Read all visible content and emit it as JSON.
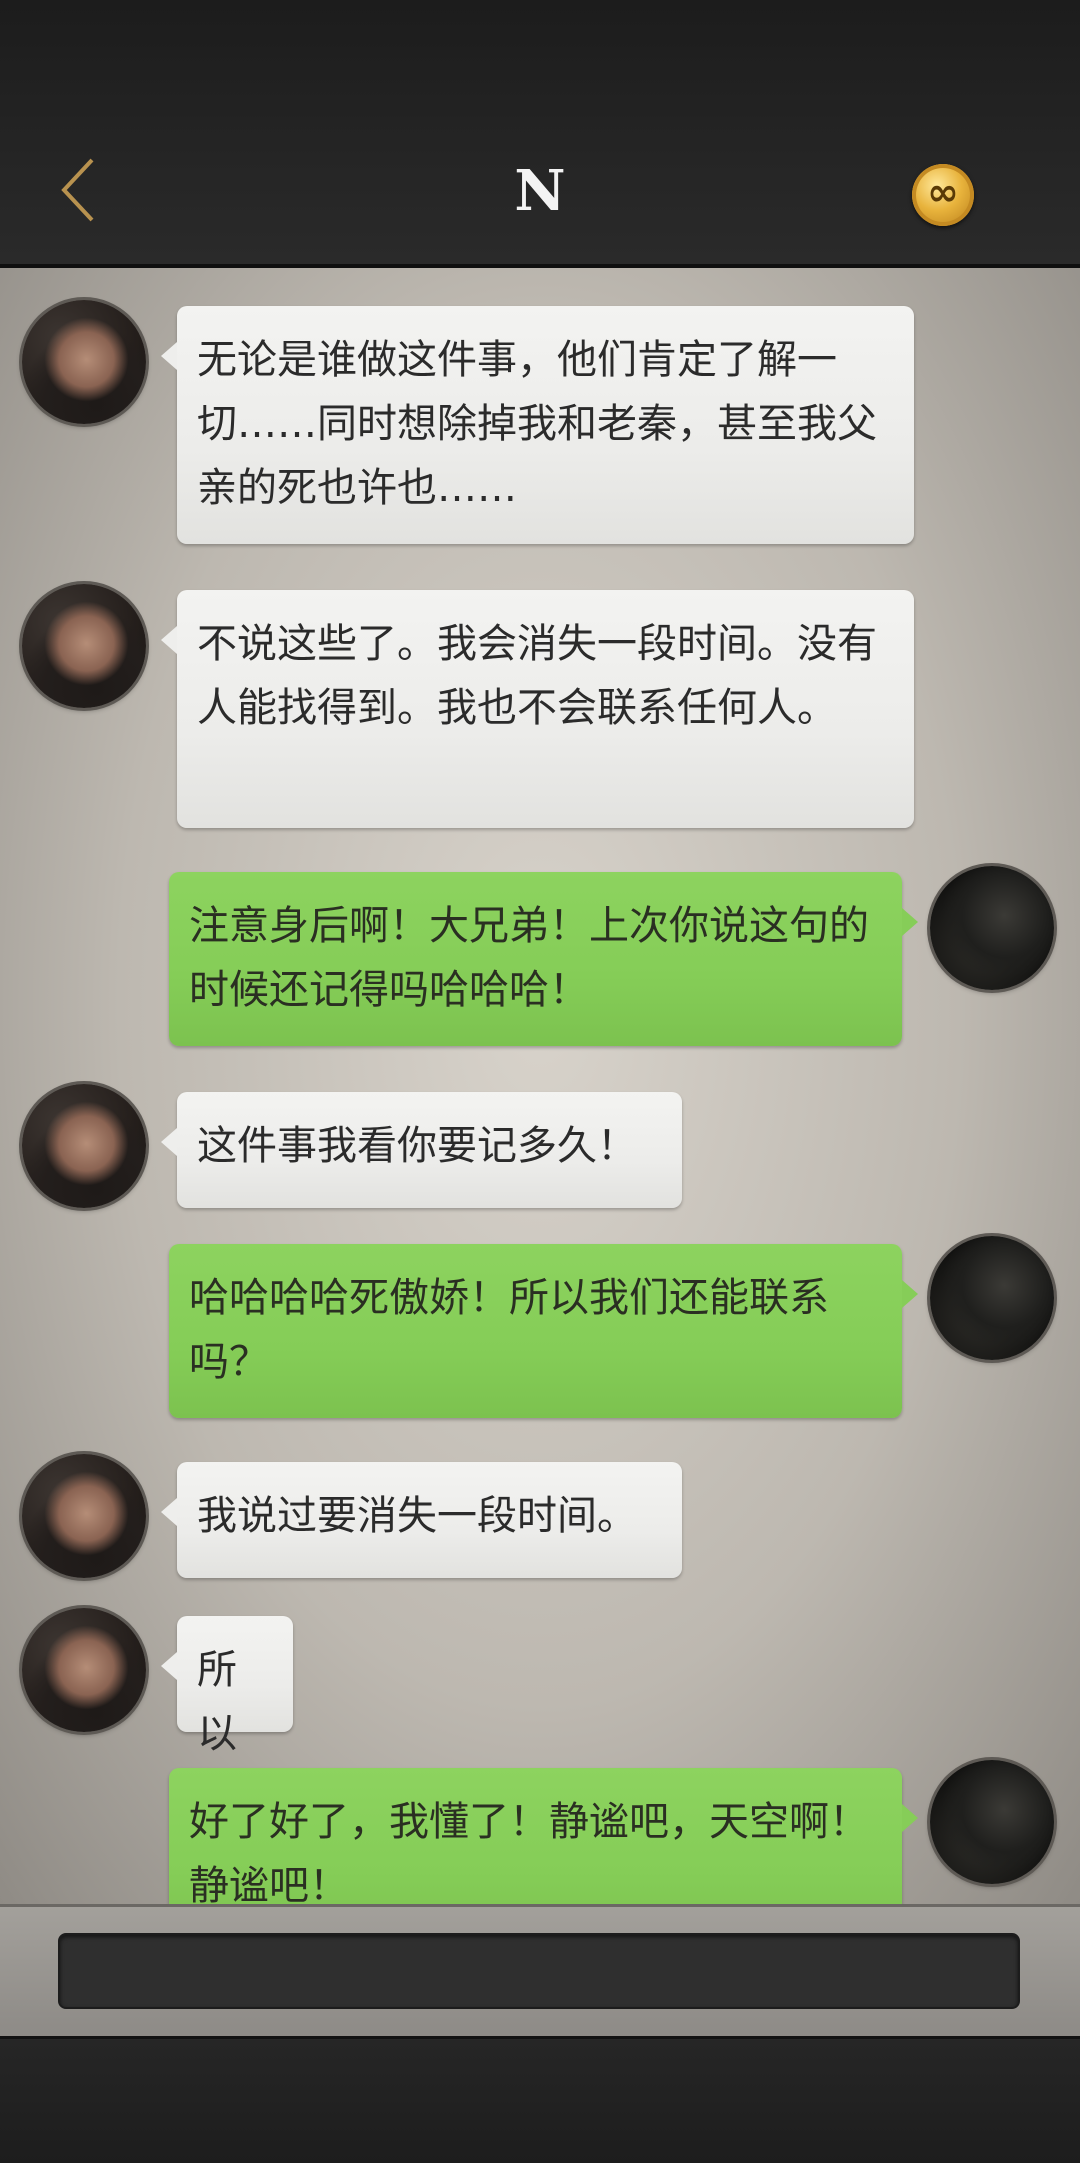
{
  "header": {
    "title": "N",
    "back_icon": "chevron-left-icon",
    "coin_icon": "infinity-coin-icon",
    "coin_symbol": "∞"
  },
  "messages": [
    {
      "side": "left",
      "avatar": "contact-avatar",
      "text": "无论是谁做这件事，他们肯定了解一切……同时想除掉我和老秦，甚至我父亲的死也许也……"
    },
    {
      "side": "left",
      "avatar": "contact-avatar",
      "text": "不说这些了。我会消失一段时间。没有人能找得到。我也不会联系任何人。"
    },
    {
      "side": "right",
      "avatar": "user-avatar",
      "text": "注意身后啊！大兄弟！上次你说这句的时候还记得吗哈哈哈！"
    },
    {
      "side": "left",
      "avatar": "contact-avatar",
      "text": "这件事我看你要记多久！"
    },
    {
      "side": "right",
      "avatar": "user-avatar",
      "text": "哈哈哈哈死傲娇！所以我们还能联系吗？"
    },
    {
      "side": "left",
      "avatar": "contact-avatar",
      "text": "我说过要消失一段时间。"
    },
    {
      "side": "left",
      "avatar": "contact-avatar",
      "text": "所以"
    },
    {
      "side": "right",
      "avatar": "user-avatar",
      "text": "好了好了，我懂了！静谧吧，天空啊！静谧吧！"
    }
  ],
  "input": {
    "value": ""
  },
  "colors": {
    "header_bg": "#252525",
    "bubble_left": "#eeeeec",
    "bubble_right": "#86cd58",
    "coin": "#e8b33c"
  }
}
